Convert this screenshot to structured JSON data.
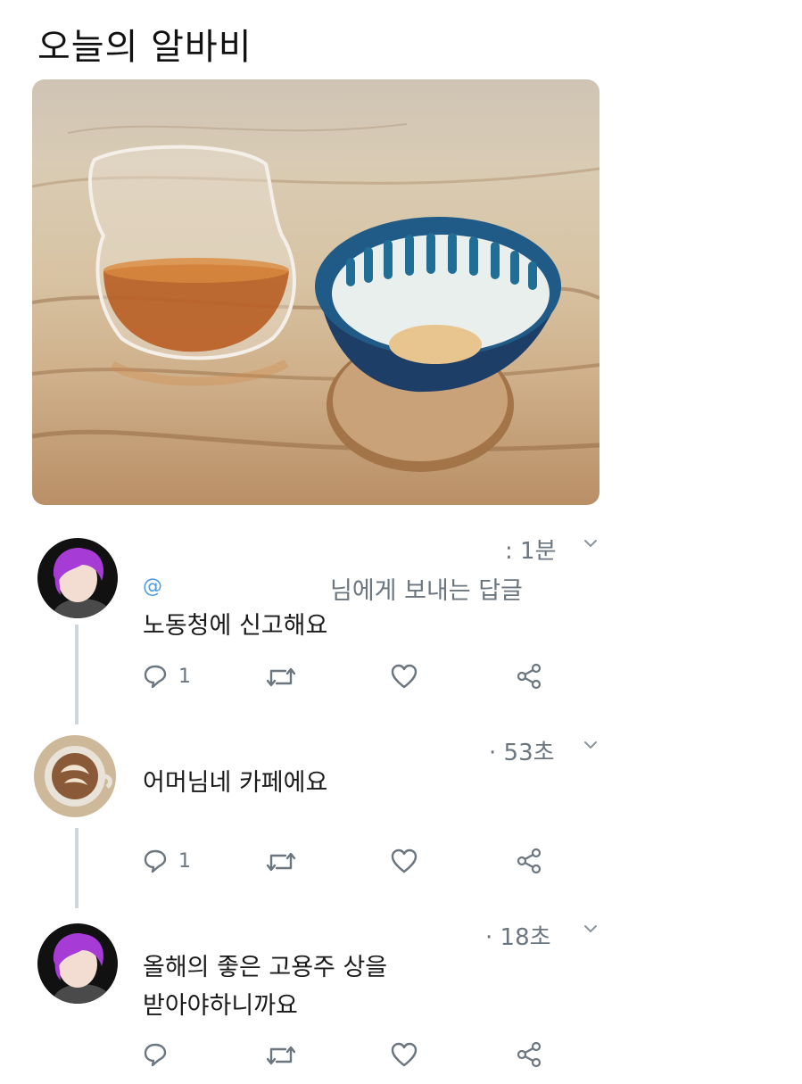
{
  "post": {
    "title": "오늘의 알바비"
  },
  "thread": {
    "replies": [
      {
        "time": "1분",
        "time_prefix": ":",
        "mention_symbol": "@",
        "reply_to": "님에게 보내는 답글",
        "text": "노동청에 신고해요",
        "reply_count": "1",
        "avatar": "purple-hair-character"
      },
      {
        "time": "53초",
        "time_prefix": "·",
        "text": "어머님네 카페에요",
        "reply_count": "1",
        "avatar": "latte-art-cup"
      },
      {
        "time": "18초",
        "time_prefix": "·",
        "text": "올해의 좋은 고용주 상을\n받아야하니까요",
        "reply_count": "",
        "avatar": "purple-hair-character"
      }
    ]
  },
  "icons": {
    "reply": "speech-bubble-icon",
    "retweet": "retweet-icon",
    "like": "heart-icon",
    "share": "share-icon",
    "more": "chevron-down-icon"
  },
  "colors": {
    "meta_gray": "#6b7680",
    "mention_blue": "#4b9ae3",
    "thread_line": "#cfd6dc",
    "hair_purple": "#a63bd6"
  }
}
